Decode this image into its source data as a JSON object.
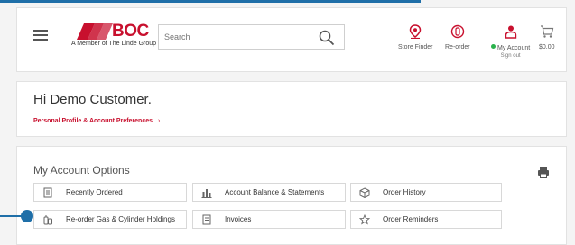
{
  "header": {
    "logo_text": "BOC",
    "logo_subtitle": "A Member of The Linde Group",
    "search_placeholder": "Search",
    "nav": {
      "store_finder": "Store Finder",
      "reorder": "Re-order",
      "my_account": "My Account",
      "sign_out": "Sign out",
      "cart_total": "$0.00"
    }
  },
  "welcome": {
    "greeting": "Hi Demo Customer.",
    "profile_link": "Personal Profile & Account Preferences",
    "chevron": "›"
  },
  "options": {
    "title": "My Account Options",
    "items": [
      {
        "label": "Recently Ordered",
        "icon": "document-icon"
      },
      {
        "label": "Account Balance & Statements",
        "icon": "bar-chart-icon"
      },
      {
        "label": "Order History",
        "icon": "box-icon"
      },
      {
        "label": "Re-order Gas & Cylinder Holdings",
        "icon": "cylinder-icon"
      },
      {
        "label": "Invoices",
        "icon": "invoice-icon"
      },
      {
        "label": "Order Reminders",
        "icon": "star-icon"
      }
    ]
  },
  "colors": {
    "brand_red": "#c8102e",
    "accent_blue": "#1f6fa8",
    "online_green": "#2bb24c"
  }
}
